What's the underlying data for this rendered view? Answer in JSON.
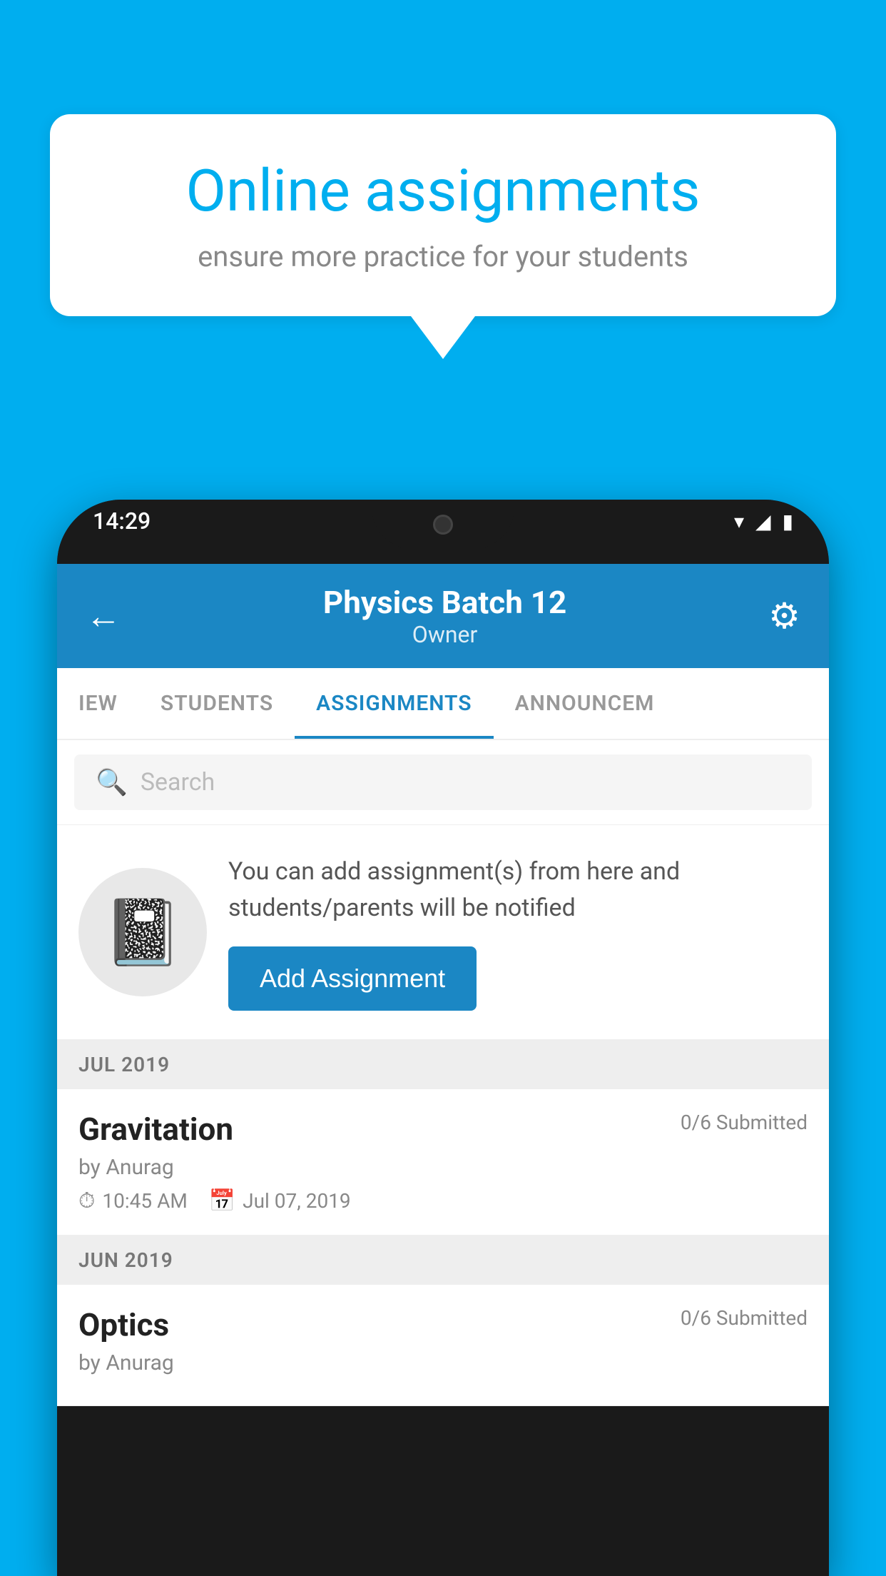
{
  "background_color": "#00AEEF",
  "speech_bubble": {
    "title": "Online assignments",
    "subtitle": "ensure more practice for your students"
  },
  "phone": {
    "status_bar": {
      "time": "14:29"
    },
    "header": {
      "title": "Physics Batch 12",
      "subtitle": "Owner",
      "back_label": "←",
      "settings_label": "⚙"
    },
    "tabs": [
      {
        "label": "IEW",
        "active": false
      },
      {
        "label": "STUDENTS",
        "active": false
      },
      {
        "label": "ASSIGNMENTS",
        "active": true
      },
      {
        "label": "ANNOUNCEM",
        "active": false
      }
    ],
    "search": {
      "placeholder": "Search"
    },
    "promo": {
      "text": "You can add assignment(s) from here and students/parents will be notified",
      "button_label": "Add Assignment"
    },
    "sections": [
      {
        "header": "JUL 2019",
        "assignments": [
          {
            "name": "Gravitation",
            "submitted": "0/6 Submitted",
            "by": "by Anurag",
            "time": "10:45 AM",
            "date": "Jul 07, 2019"
          }
        ]
      },
      {
        "header": "JUN 2019",
        "assignments": [
          {
            "name": "Optics",
            "submitted": "0/6 Submitted",
            "by": "by Anurag",
            "time": "",
            "date": ""
          }
        ]
      }
    ]
  }
}
